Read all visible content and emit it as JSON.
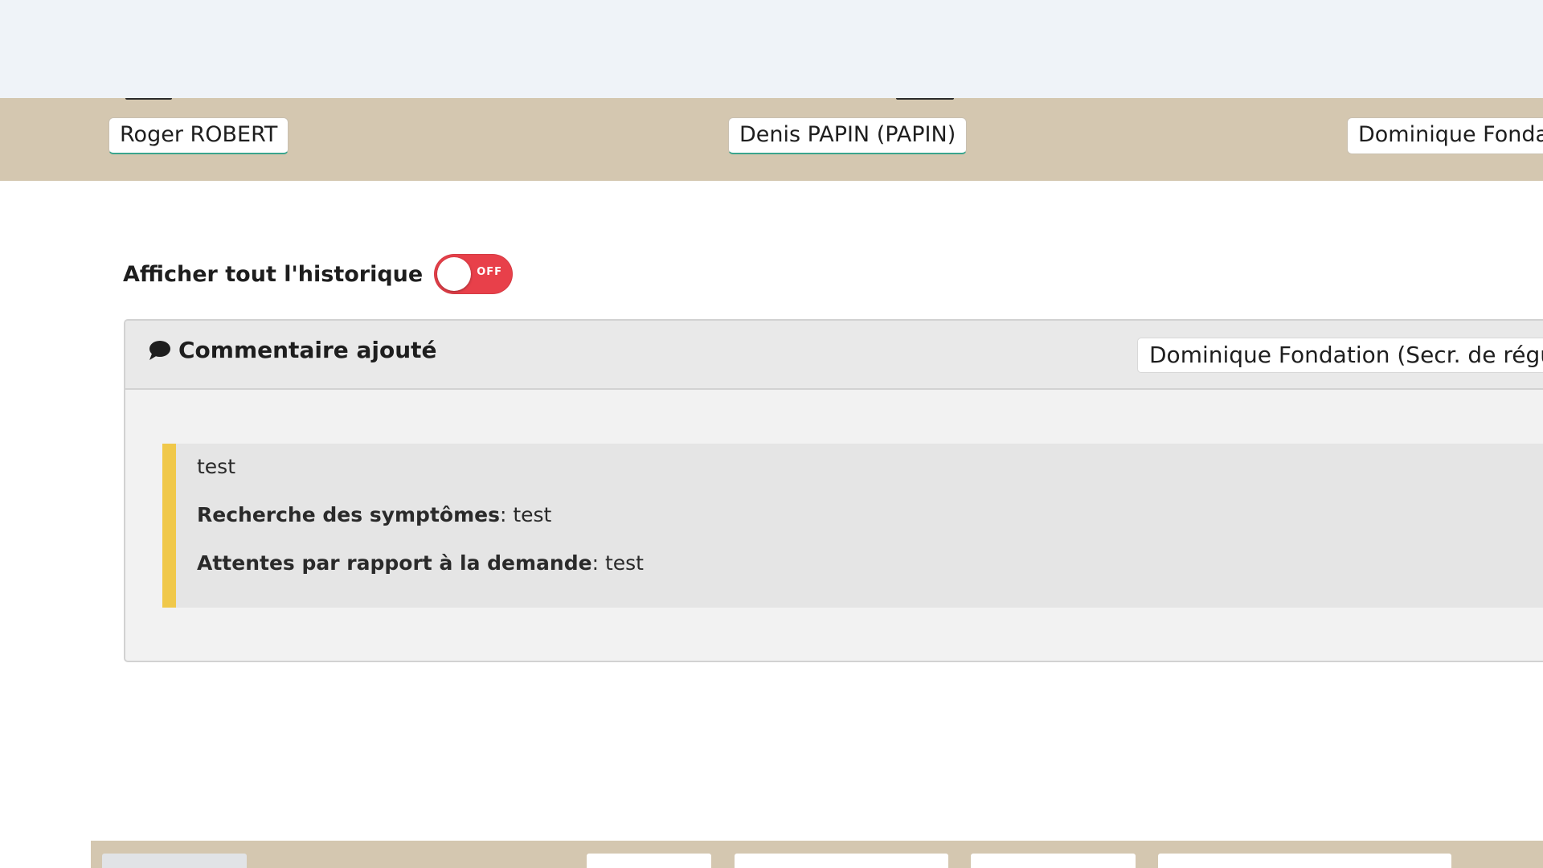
{
  "people": [
    {
      "name": "Roger ROBERT"
    },
    {
      "name": "Denis PAPIN (PAPIN)"
    },
    {
      "name": "Dominique Fonda"
    }
  ],
  "history": {
    "label": "Afficher tout l'historique",
    "toggle_state": "OFF"
  },
  "event": {
    "icon": "comment-icon",
    "title": "Commentaire ajouté",
    "author": "Dominique Fondation (Secr. de régula",
    "comment": "test",
    "fields": [
      {
        "key": "Recherche des symptômes",
        "value": ": test"
      },
      {
        "key": "Attentes par rapport à la demande",
        "value": ": test"
      }
    ]
  },
  "colors": {
    "people_bar": "#d4c7b0",
    "toggle_off": "#e8404a",
    "quote_accent": "#f0c84a",
    "chip_underline": "#3aa58d"
  }
}
